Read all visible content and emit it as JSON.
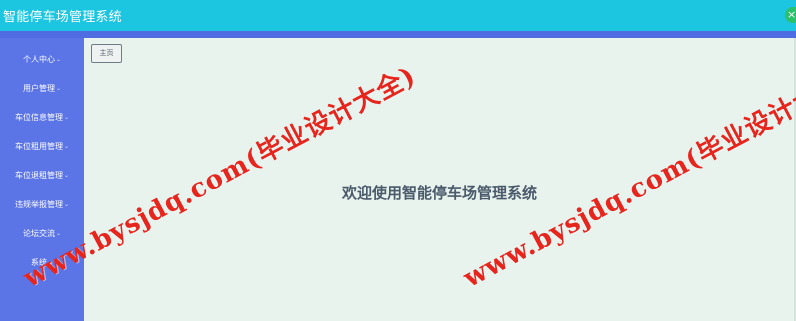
{
  "app": {
    "title": "智能停车场管理系统",
    "close_label": "×"
  },
  "sidebar": {
    "items": [
      {
        "label": "个人中心"
      },
      {
        "label": "用户管理"
      },
      {
        "label": "车位信息管理"
      },
      {
        "label": "车位租用管理"
      },
      {
        "label": "车位退租管理"
      },
      {
        "label": "违规举报管理"
      },
      {
        "label": "论坛交流"
      },
      {
        "label": "系统"
      }
    ]
  },
  "tabs": {
    "home_label": "主页"
  },
  "main": {
    "welcome_text": "欢迎使用智能停车场管理系统"
  },
  "watermark": {
    "text": "www.bysjdq.com(毕业设计大全)"
  },
  "colors": {
    "header": "#1cc5e0",
    "subbar": "#4f6de0",
    "sidebar": "#5b74e6",
    "content_bg": "#e9f3ee",
    "watermark": "#e8251c"
  }
}
